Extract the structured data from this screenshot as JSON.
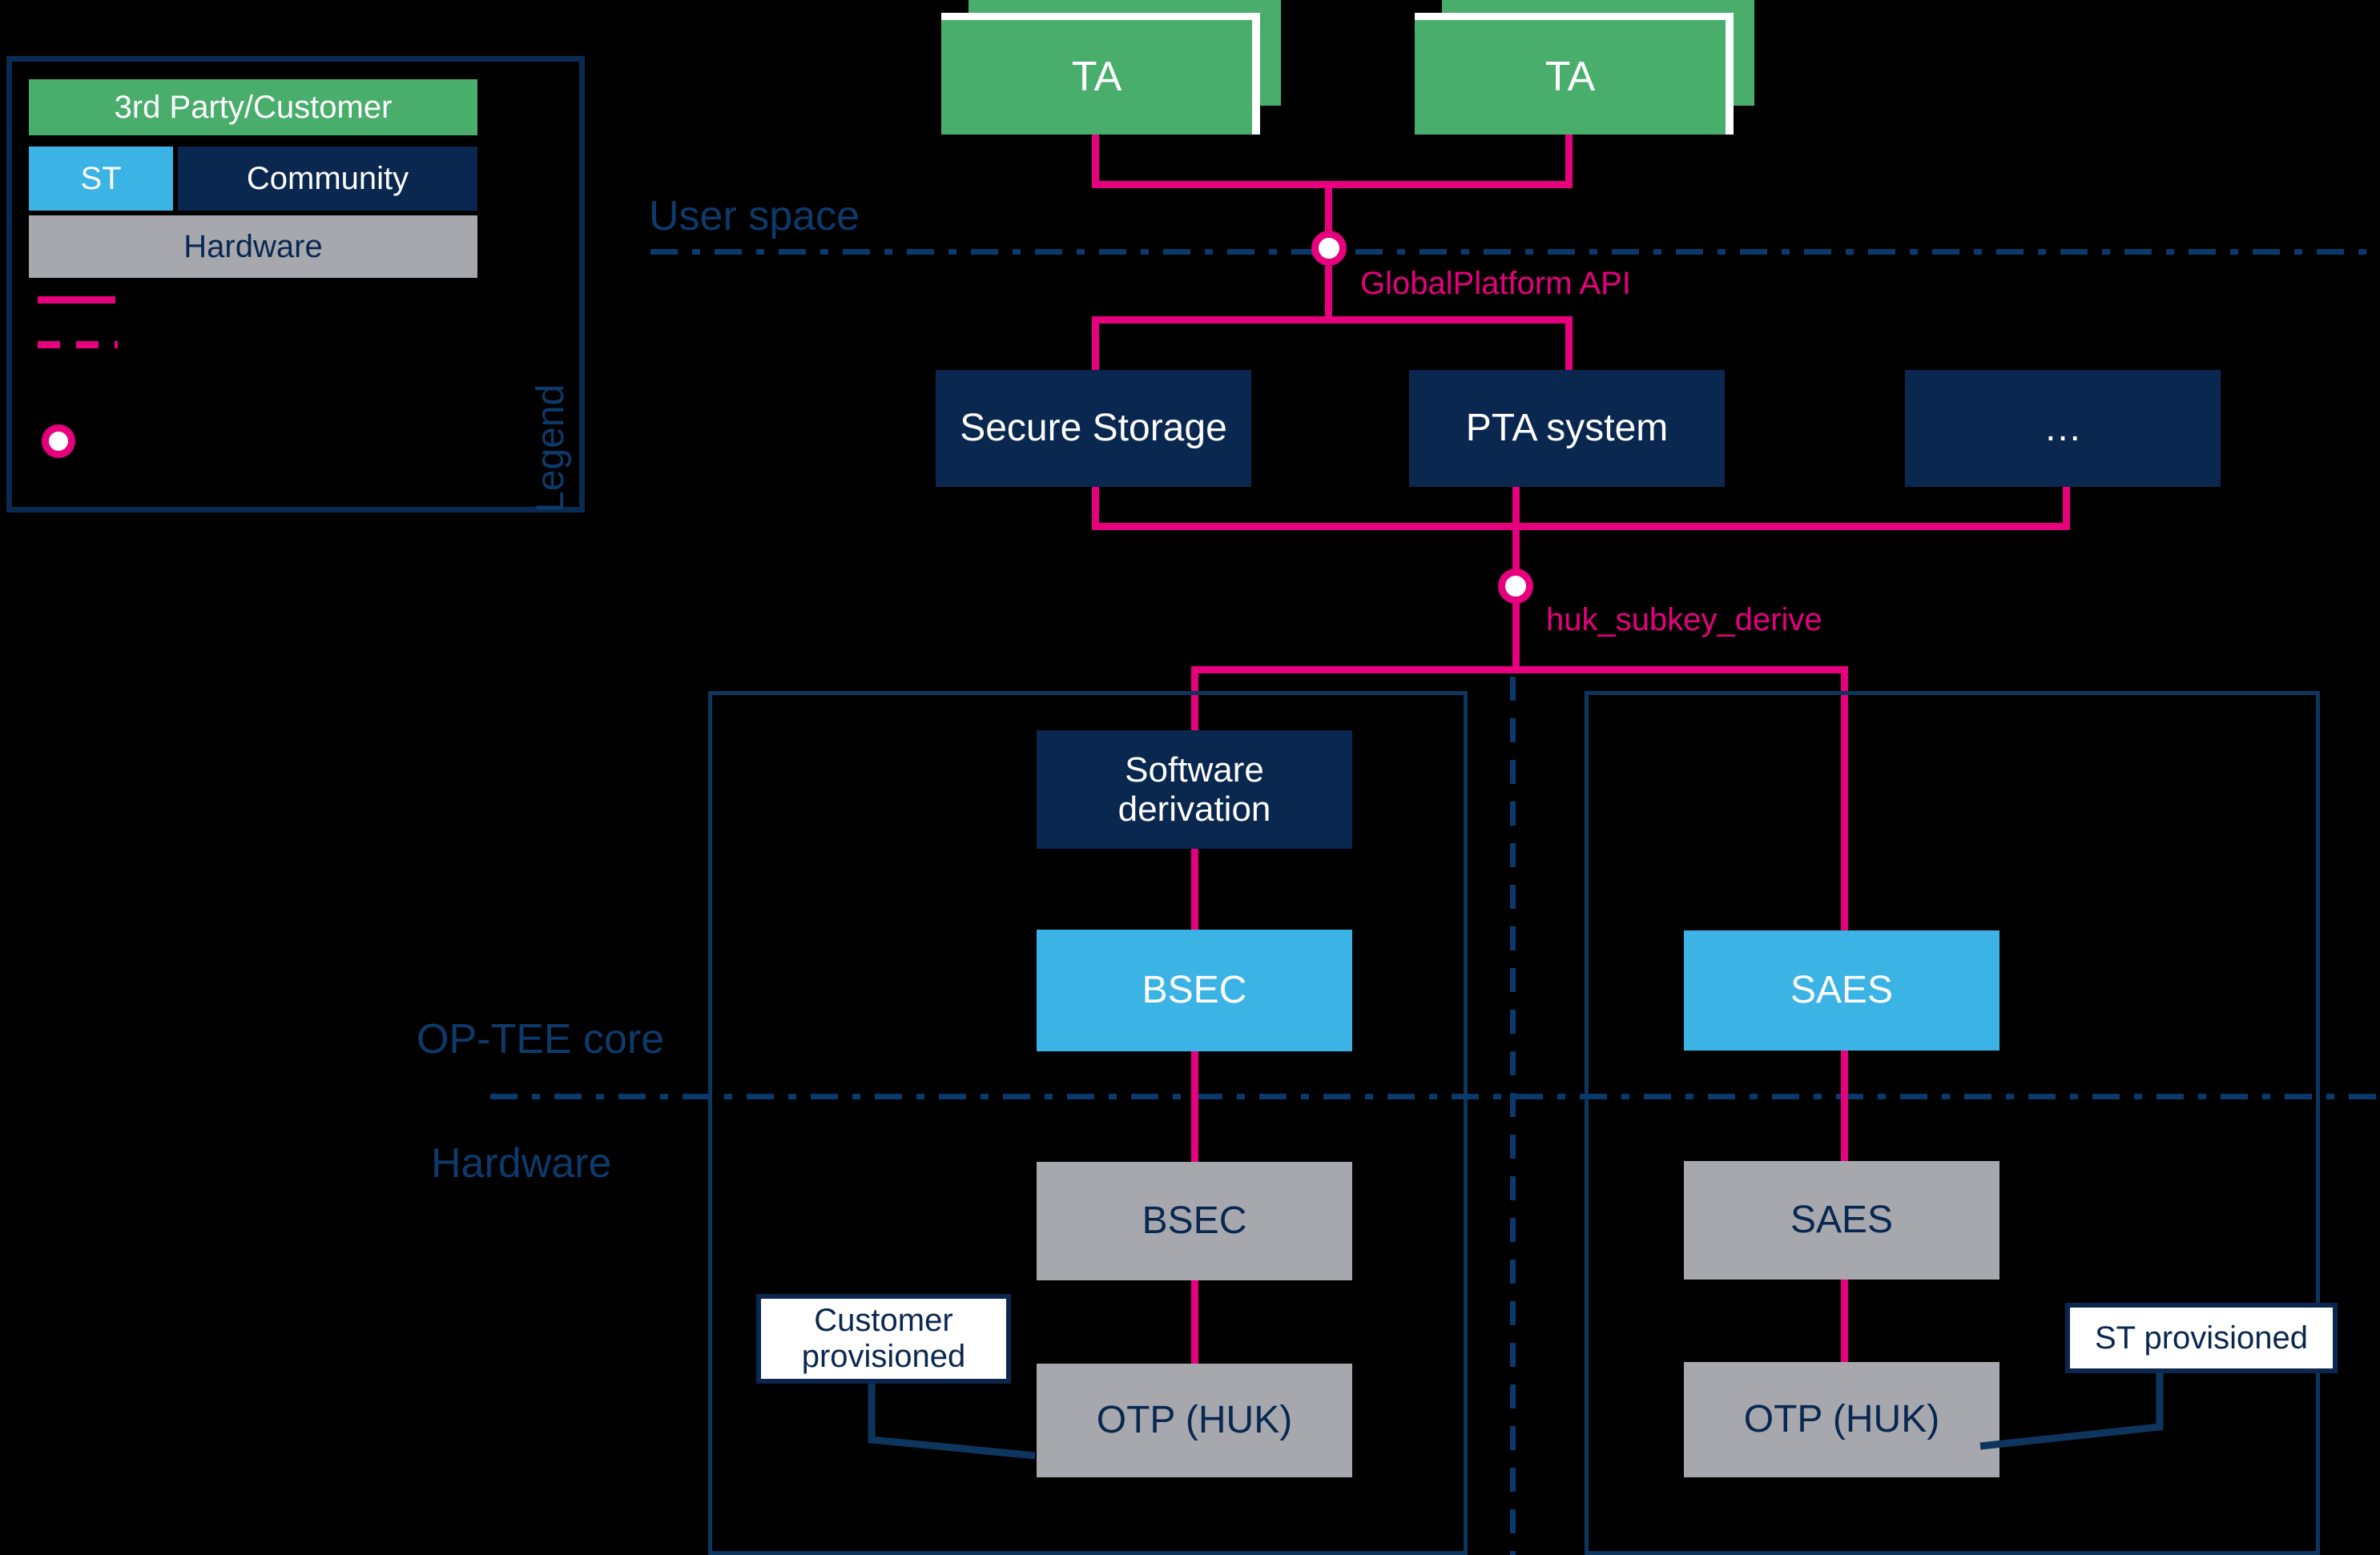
{
  "legend": {
    "title": "Legend",
    "swatches": [
      {
        "label": "3rd Party/Customer",
        "color": "#49ae6c"
      },
      {
        "label": "ST",
        "color": "#3bb4e5"
      },
      {
        "label": "Community",
        "color": "#0a2750"
      },
      {
        "label": "Hardware",
        "color": "#a6a8ae"
      }
    ],
    "line_solid_color": "#e6007e",
    "line_dashed_color": "#e6007e",
    "node_color": "#e6007e"
  },
  "layers": {
    "user_space": "User space",
    "optee_core": "OP-TEE core",
    "hardware": "Hardware"
  },
  "nodes": {
    "ta_left": "TA",
    "ta_right": "TA",
    "secure_storage": "Secure Storage",
    "pta_system": "PTA system",
    "ellipsis": "…",
    "software_derivation": "Software\nderivation",
    "software_derivation_line1": "Software",
    "software_derivation_line2": "derivation",
    "bsec_core": "BSEC",
    "saes_core": "SAES",
    "bsec_hw": "BSEC",
    "saes_hw": "SAES",
    "otp_huk_left": "OTP (HUK)",
    "otp_huk_right": "OTP (HUK)"
  },
  "interfaces": {
    "globalplatform_api": "GlobalPlatform API",
    "huk_subkey_derive": "huk_subkey_derive"
  },
  "callouts": {
    "customer_provisioned_line1": "Customer",
    "customer_provisioned_line2": "provisioned",
    "st_provisioned": "ST provisioned"
  },
  "colors": {
    "pink": "#e6007e",
    "navy": "#0a2750",
    "cyan": "#3bb4e5",
    "gray": "#a6a8ae",
    "green": "#49ae6c",
    "outline": "#0d355e",
    "background": "#000000"
  }
}
